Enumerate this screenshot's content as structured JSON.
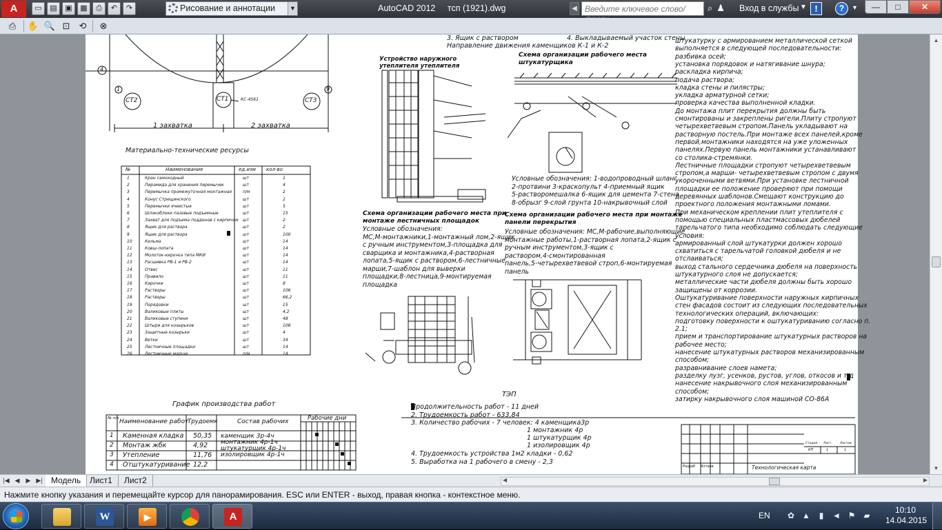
{
  "titlebar": {
    "app_letter": "A",
    "quick_access": [
      "new-icon",
      "open-icon",
      "save-icon",
      "save-as-icon",
      "plot-icon",
      "undo-icon",
      "redo-icon"
    ],
    "workspace": "Рисование и аннотации",
    "app_name": "AutoCAD 2012",
    "file_name": "тсп (1921).dwg",
    "search_placeholder": "Введите ключевое слово/фразу",
    "login": "Вход в службы",
    "exchange_label": "!",
    "help_label": "?",
    "window_buttons": {
      "min": "—",
      "max": "□",
      "close": "✕"
    }
  },
  "preview_toolbar": {
    "buttons": [
      "plot-icon",
      "pan-icon",
      "zoom-icon",
      "zoom-window-icon",
      "zoom-original-icon",
      "close-preview-icon"
    ]
  },
  "drawing": {
    "axis_labels": {
      "a4": "4",
      "a1": "1",
      "a9": "9"
    },
    "circles": {
      "st2": "СТ2",
      "st1": "СТ1",
      "st3": "СТ3",
      "ks": "КС-4561"
    },
    "zones": {
      "z1": "1 захватка",
      "z2": "2 захватка"
    },
    "resources_title": "Материально-технические ресурсы",
    "resources_table": {
      "headers": [
        "№",
        "Наименование",
        "ед.изм",
        "кол-во"
      ],
      "rows": [
        [
          "1",
          "Кран самоходный",
          "шт",
          "1"
        ],
        [
          "2",
          "Пирамида для хранения перемычек",
          "шт",
          "4"
        ],
        [
          "3",
          "Перемычка промежуточная монтажная",
          "п/м",
          "2"
        ],
        [
          "4",
          "Конус Стрещинского",
          "шт",
          "2"
        ],
        [
          "5",
          "Перемычки ячеистые",
          "шт",
          "5"
        ],
        [
          "6",
          "Шлакоблоки пазовые подъемные",
          "шт",
          "15"
        ],
        [
          "7",
          "Захват для подъема поддонов с кирпичом",
          "шт",
          "2"
        ],
        [
          "8",
          "Ящик для раствора",
          "шт",
          "2"
        ],
        [
          "9",
          "Ящик для раствора",
          "шт",
          "100"
        ],
        [
          "10",
          "Кельма",
          "шт",
          "14"
        ],
        [
          "11",
          "Ковш-лопата",
          "шт",
          "14"
        ],
        [
          "12",
          "Молоток-кирочка типа МКИ",
          "шт",
          "14"
        ],
        [
          "13",
          "Расшивка РВ-1 и РВ-2",
          "шт",
          "14"
        ],
        [
          "14",
          "Отвес",
          "шт",
          "11"
        ],
        [
          "15",
          "Правило",
          "шт",
          "11"
        ],
        [
          "16",
          "Кирочки",
          "шт",
          "8"
        ],
        [
          "17",
          "Растворы",
          "шт",
          "106"
        ],
        [
          "18",
          "Растворы",
          "шт",
          "66,2"
        ],
        [
          "19",
          "Порядовки",
          "шт",
          "15"
        ],
        [
          "20",
          "Валиковые плиты",
          "шт",
          "4,2"
        ],
        [
          "21",
          "Валиковые ступени",
          "шт",
          "48"
        ],
        [
          "22",
          "Штыри для козырьков",
          "шт",
          "108"
        ],
        [
          "23",
          "Защитные козырьки",
          "шт",
          "4"
        ],
        [
          "24",
          "Ветки",
          "шт",
          "34"
        ],
        [
          "25",
          "Лестничные площадки",
          "шт",
          "14"
        ],
        [
          "26",
          "Лестничные марши",
          "п/м",
          "14"
        ]
      ]
    },
    "schedule": {
      "title": "График производства работ",
      "headers": [
        "№ п/п",
        "Наименование работ",
        "Трудоемк",
        "Состав рабочих",
        "Рабочие дни"
      ],
      "rows": [
        [
          "1",
          "Каменная кладка",
          "50,35"
        ],
        [
          "2",
          "Монтаж жбк",
          "4,92"
        ],
        [
          "3",
          "Утепление",
          "11,76"
        ],
        [
          "4",
          "Отштукатуривание",
          "12,2"
        ]
      ],
      "crew": [
        "каменщик 3р-4ч",
        "монтажник 4р-1ч",
        "штукатурщик 4р-1ч",
        "изолировщик 4р-1ч"
      ]
    },
    "top_notes": {
      "n3": "3. Ящик с раствором",
      "n4": "4. Выкладываемый участок стены",
      "dir": "Направление движения каменщиков К-1 и К-2"
    },
    "insulation_title": [
      "Устройство наружного",
      "утеплителя утеплителя"
    ],
    "plaster_title": [
      "Схема организации рабочего места",
      "штукатурщика"
    ],
    "plaster_legend": [
      "Условные обозначения: 1-водопроводный шланг",
      "2-протвини 3-краскопульт 4-приемный ящик",
      "5-растворомешалка 6-ящик для цемента 7-стена",
      "8-обрызг 9-слой грунта 10-накрывочный слой"
    ],
    "stair_title": [
      "Схема организации рабочего места при",
      "монтаже лестничных площадок"
    ],
    "stair_legend": [
      "Условные обозначения:",
      "МС,М-монтажники,1-монтажный лом,2-ящик",
      "с ручным инструментом,3-площадка для",
      "сварщика и монтажника,4-растворная",
      "лопата,5-ящик с раствором,6-лестничные",
      "марши,7-шаблон для выверки",
      "площадки,8-лестница,9-монтируемая",
      "площадка"
    ],
    "slab_title": [
      "Схема организации рабочего места при монтаже",
      "панели перекрытия"
    ],
    "slab_legend": [
      "Условные обозначения: МС,М-рабочие,выполняющие",
      "монтажные работы,1-растворная лопата,2-ящик с",
      "ручным инструментом,3-ящик с",
      "раствором,4-смонтированная",
      "панель,5-четырехветвевой строп,6-монтируемая",
      "панель"
    ],
    "tep": {
      "title": "ТЭП",
      "lines": [
        "Продолжительность работ - 11 дней",
        "2. Трудоемкость работ - 633,84",
        "3. Количество рабочих - 7 человек: 4 каменщика3р"
      ],
      "workers": [
        "1 монтажник 4р",
        "1 штукатурщик 4р",
        "1 изолировщик 4р"
      ],
      "lines2": [
        "4. Трудоемкость устройства 1м2 кладки - 0,62",
        "5. Выработка на 1 рабочего в смену - 2,3"
      ]
    },
    "right_text": [
      "штукатурку с армированием металлической сеткой",
      "выполняется в следующей последовательности:",
      "разбивка осей;",
      "установка порядовок и натягивание шнура;",
      "раскладка кирпича;",
      "подача раствора;",
      "кладка стены и пилястры;",
      "укладка арматурной сетки;",
      "проверка качества выполненной кладки.",
      "До монтажа плит перекрытия должны быть",
      "смонтированы и закреплены ригели.Плиту стропуют",
      "четырехветвевым стропом.Панель укладывают на",
      "растворную постель.При монтаже всех панелей,кроме",
      "первой,монтажники находятся на уже уложенных",
      "панелях.Первую панель монтажники устанавливают",
      "со столика-стремянки.",
      "Лестничные площадки стропуют четырехветвевым",
      "стропом,а марши- четырехветвевым стропом с двумя",
      "укороченными ветвями.При установке лестничной",
      "площадки ее положение проверяют при помощи",
      "деревянных шаблонов.Смещают конструкцию до",
      "проектного положения монтажными ломами.",
      "При механическом креплении плит утеплителя с",
      "помощью специальных пластмассовых дюбелей",
      "тарельчатого типа необходимо соблюдать следующие",
      "условия:",
      "армированный слой штукатурки должен хорошо",
      "схватиться с тарельчатой головкой дюбеля и не",
      "отслаиваться;",
      "выход стального сердечника дюбеля на поверхность",
      "штукатурного слоя не допускается;",
      "металлические части дюбеля должны быть хорошо",
      "защищены от коррозии.",
      "Оштукатуривание поверхности наружных кирпичных",
      "стен фасадов состоит из следующих последовательных",
      "технологических операций, включающих:",
      "подготовку поверхности к оштукатуриванию согласно п.",
      "2.1;",
      "прием и транспортирование штукатурных растворов на",
      "рабочее место;",
      "нанесение штукатурных растворов механизированным",
      "способом;",
      "разравнивание слоев намета;",
      "разделку лузг, усенков, рустов, углов, откосов и т.д",
      "нанесение накрывочного слоя механизированным",
      "способом;",
      "затирку накрывочного слоя машиной СО-86А"
    ],
    "stamp": {
      "tech_map": "Технологическая карта",
      "stage": "Стадия",
      "sheet": "Лист",
      "sheets": "Листов",
      "stage_val": "КП",
      "sheet_val": "1",
      "sheets_val": "1",
      "dev": "Разраб",
      "dev_name": "Алтаев"
    }
  },
  "tabs": [
    "Модель",
    "Лист1",
    "Лист2"
  ],
  "command_line": "Нажмите кнопку указания и перемещайте курсор для панорамирования. ESC или ENTER - выход, правая кнопка - контекстное меню.",
  "taskbar": {
    "apps": [
      "explorer-icon",
      "word-icon",
      "media-player-icon",
      "chrome-icon",
      "autocad-icon"
    ],
    "lang": "EN",
    "time": "10:10",
    "date": "14.04.2015"
  }
}
